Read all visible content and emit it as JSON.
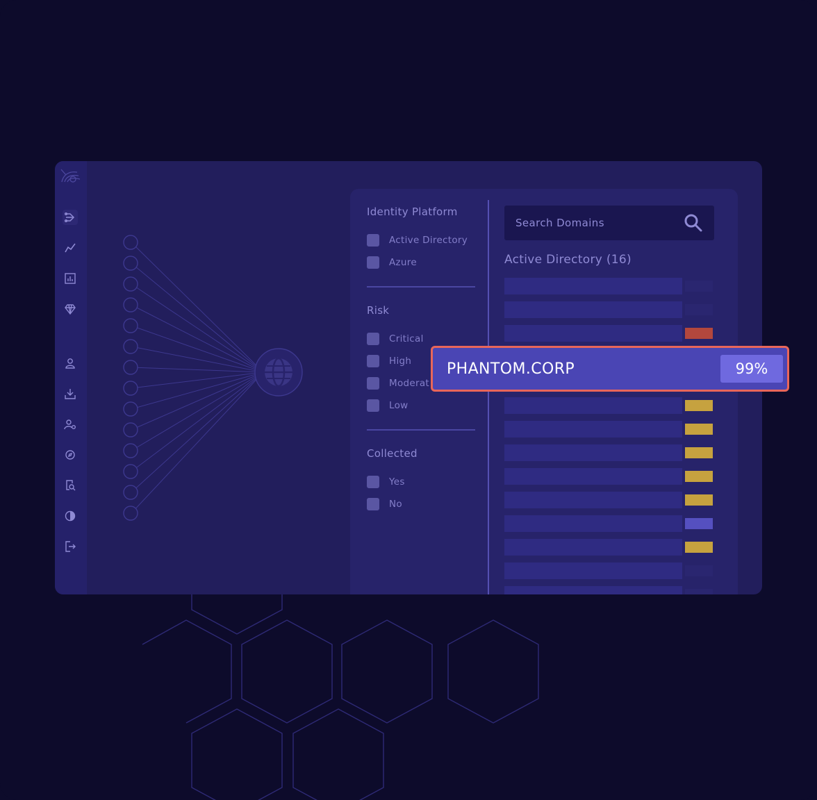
{
  "filters": {
    "identity_platform": {
      "title": "Identity Platform",
      "options": [
        "Active Directory",
        "Azure"
      ]
    },
    "risk": {
      "title": "Risk",
      "options": [
        "Critical",
        "High",
        "Moderat",
        "Low"
      ]
    },
    "collected": {
      "title": "Collected",
      "options": [
        "Yes",
        "No"
      ]
    }
  },
  "search": {
    "placeholder": "Search Domains",
    "icon": "search-icon"
  },
  "list": {
    "title": "Active Directory (16)",
    "row_badges": [
      "none",
      "none",
      "critical",
      "high",
      "high",
      "high",
      "high",
      "high",
      "low",
      "high",
      "none",
      "none",
      "high",
      "critical"
    ]
  },
  "highlight": {
    "name": "PHANTOM.CORP",
    "score": "99%"
  },
  "sidebar": {
    "icons": [
      "graph-flow-icon",
      "trend-line-icon",
      "report-chart-icon",
      "diamond-icon",
      "user-icon",
      "download-icon",
      "user-settings-icon",
      "compass-icon",
      "file-search-icon",
      "contrast-icon",
      "logout-icon"
    ]
  },
  "colors": {
    "background": "#0d0b2b",
    "window": "#221e5c",
    "accent": "#4a45b4",
    "highlight_border": "#e9665a",
    "critical": "#b3473d",
    "high": "#c6a23f",
    "low": "#5550c0",
    "none": "#2a2670"
  }
}
